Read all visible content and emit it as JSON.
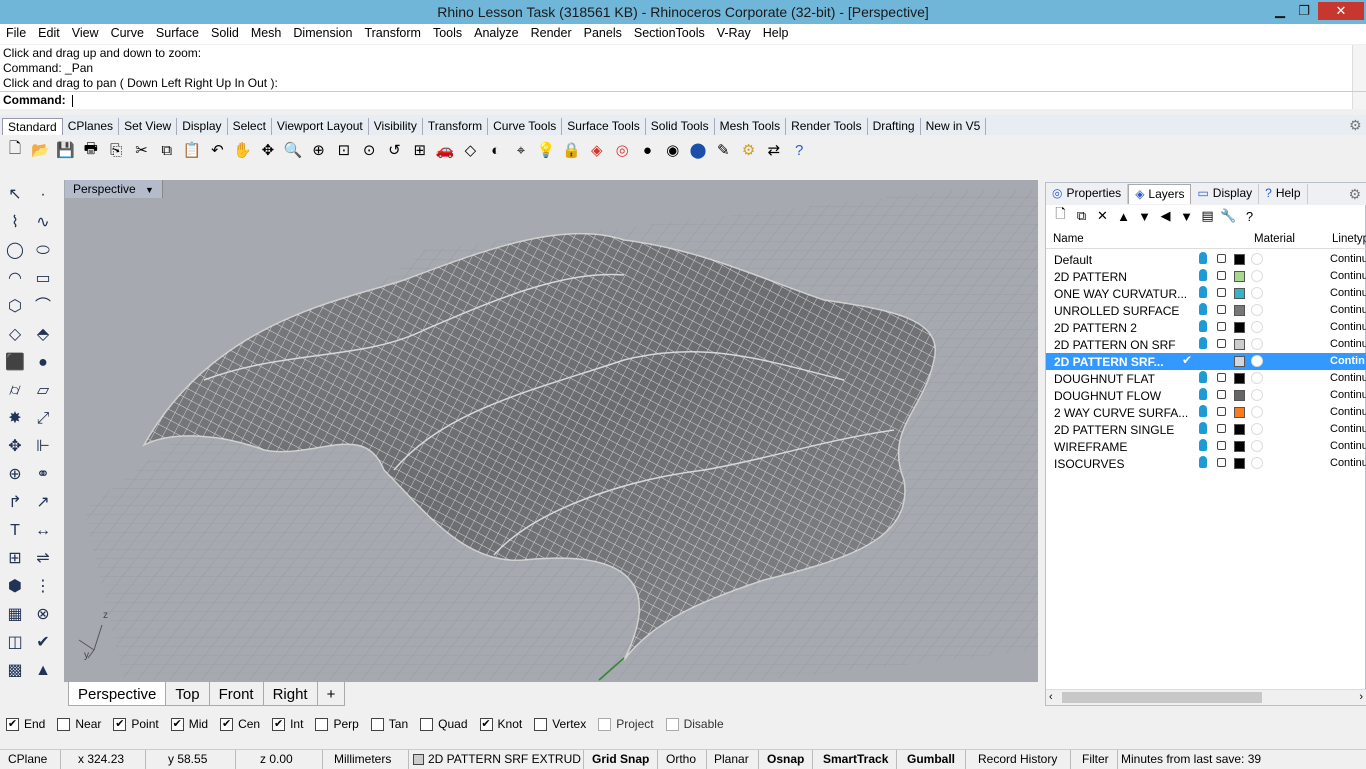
{
  "window": {
    "title": "Rhino Lesson Task (318561 KB) - Rhinoceros Corporate (32-bit) - [Perspective]"
  },
  "menu": [
    "File",
    "Edit",
    "View",
    "Curve",
    "Surface",
    "Solid",
    "Mesh",
    "Dimension",
    "Transform",
    "Tools",
    "Analyze",
    "Render",
    "Panels",
    "SectionTools",
    "V-Ray",
    "Help"
  ],
  "command_history": [
    "Click and drag up and down to zoom:",
    "Command: _Pan",
    "Click and drag to pan ( Down  Left  Right  Up  In  Out ):"
  ],
  "command_prompt": "Command:",
  "toolbar_tabs": [
    "Standard",
    "CPlanes",
    "Set View",
    "Display",
    "Select",
    "Viewport Layout",
    "Visibility",
    "Transform",
    "Curve Tools",
    "Surface Tools",
    "Solid Tools",
    "Mesh Tools",
    "Render Tools",
    "Drafting",
    "New in V5"
  ],
  "toolbar_icons": [
    "new-file-icon",
    "open-folder-icon",
    "save-icon",
    "print-icon",
    "import-icon",
    "cut-icon",
    "copy-icon",
    "paste-icon",
    "undo-icon",
    "pan-hand-icon",
    "rotate-view-icon",
    "zoom-icon",
    "zoom-window-icon",
    "zoom-extents-icon",
    "zoom-selected-icon",
    "undo-view-icon",
    "four-viewports-icon",
    "car-named-view-icon",
    "cplane-icon",
    "show-hide-icon",
    "snap-icon",
    "light-bulb-icon",
    "lock-icon",
    "layer-icon",
    "color-wheel-icon",
    "shaded-sphere-icon",
    "rendered-sphere-icon",
    "render-sphere-icon",
    "ghost-icon",
    "options-gear-icon",
    "match-properties-icon",
    "help-icon"
  ],
  "viewport": {
    "title": "Perspective",
    "axis_labels": {
      "z": "z",
      "y": "y"
    }
  },
  "viewport_tabs": [
    "Perspective",
    "Top",
    "Front",
    "Right",
    "+"
  ],
  "panel": {
    "tabs": [
      "Properties",
      "Layers",
      "Display",
      "Help"
    ],
    "columns": {
      "name": "Name",
      "material": "Material",
      "linetype": "Linetyp"
    },
    "layers": [
      {
        "name": "Default",
        "color": "#000000",
        "linetype": "Continu",
        "selected": false
      },
      {
        "name": "2D PATTERN",
        "color": "#a6d98c",
        "linetype": "Continu",
        "selected": false
      },
      {
        "name": "ONE WAY CURVATUR...",
        "color": "#33b5c8",
        "linetype": "Continu",
        "selected": false
      },
      {
        "name": "UNROLLED SURFACE",
        "color": "#777777",
        "linetype": "Continu",
        "selected": false
      },
      {
        "name": "2D PATTERN 2",
        "color": "#000000",
        "linetype": "Continu",
        "selected": false
      },
      {
        "name": "2D PATTERN ON SRF",
        "color": "#cccccc",
        "linetype": "Continu",
        "selected": false
      },
      {
        "name": "2D PATTERN SRF...",
        "color": "#cfd8e0",
        "linetype": "Contin",
        "selected": true,
        "check": "✔"
      },
      {
        "name": "DOUGHNUT FLAT",
        "color": "#000000",
        "linetype": "Continu",
        "selected": false
      },
      {
        "name": "DOUGHNUT FLOW",
        "color": "#666666",
        "linetype": "Continu",
        "selected": false
      },
      {
        "name": "2 WAY CURVE SURFA...",
        "color": "#ff7a1a",
        "linetype": "Continu",
        "selected": false
      },
      {
        "name": "2D PATTERN SINGLE",
        "color": "#000000",
        "linetype": "Continu",
        "selected": false
      },
      {
        "name": "WIREFRAME",
        "color": "#000000",
        "linetype": "Continu",
        "selected": false
      },
      {
        "name": "ISOCURVES",
        "color": "#000000",
        "linetype": "Continu",
        "selected": false
      }
    ]
  },
  "osnaps": [
    {
      "label": "End",
      "checked": true,
      "enabled": true
    },
    {
      "label": "Near",
      "checked": false,
      "enabled": true
    },
    {
      "label": "Point",
      "checked": true,
      "enabled": true
    },
    {
      "label": "Mid",
      "checked": true,
      "enabled": true
    },
    {
      "label": "Cen",
      "checked": true,
      "enabled": true
    },
    {
      "label": "Int",
      "checked": true,
      "enabled": true
    },
    {
      "label": "Perp",
      "checked": false,
      "enabled": true
    },
    {
      "label": "Tan",
      "checked": false,
      "enabled": true
    },
    {
      "label": "Quad",
      "checked": false,
      "enabled": true
    },
    {
      "label": "Knot",
      "checked": true,
      "enabled": true
    },
    {
      "label": "Vertex",
      "checked": false,
      "enabled": true
    },
    {
      "label": "Project",
      "checked": false,
      "enabled": false
    },
    {
      "label": "Disable",
      "checked": false,
      "enabled": false
    }
  ],
  "status": {
    "cplane": "CPlane",
    "x": "x 324.23",
    "y": "y 58.55",
    "z": "z 0.00",
    "units": "Millimeters",
    "layer": "2D PATTERN SRF EXTRUD",
    "grid_snap": "Grid Snap",
    "ortho": "Ortho",
    "planar": "Planar",
    "osnap": "Osnap",
    "smarttrack": "SmartTrack",
    "gumball": "Gumball",
    "record_history": "Record History",
    "filter": "Filter",
    "minutes": "Minutes from last save: 39"
  }
}
